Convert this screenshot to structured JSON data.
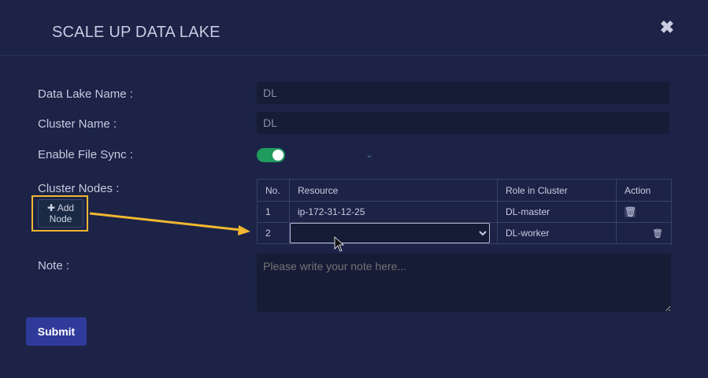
{
  "modal": {
    "title": "SCALE UP DATA LAKE",
    "close_icon": "close-icon"
  },
  "form": {
    "data_lake_name_label": "Data Lake Name :",
    "data_lake_name_value": "DL",
    "cluster_name_label": "Cluster Name :",
    "cluster_name_value": "DL",
    "file_sync_label": "Enable File Sync :",
    "file_sync_enabled": true,
    "cluster_nodes_label": "Cluster Nodes :",
    "add_node_icon": "plus-icon",
    "add_node_label": "Add Node",
    "note_label": "Note :",
    "note_placeholder": "Please write your note here...",
    "submit_label": "Submit"
  },
  "nodes_table": {
    "headers": [
      "No.",
      "Resource",
      "Role in Cluster",
      "Action"
    ],
    "rows": [
      {
        "no": "1",
        "resource": "ip-172-31-12-25",
        "role": "DL-master"
      },
      {
        "no": "2",
        "resource": "",
        "role": "DL-worker"
      }
    ]
  },
  "colors": {
    "background": "#1c2347",
    "toggle_on": "#1f9b5e",
    "submit": "#2f3a9a",
    "highlight": "#f1b731"
  }
}
